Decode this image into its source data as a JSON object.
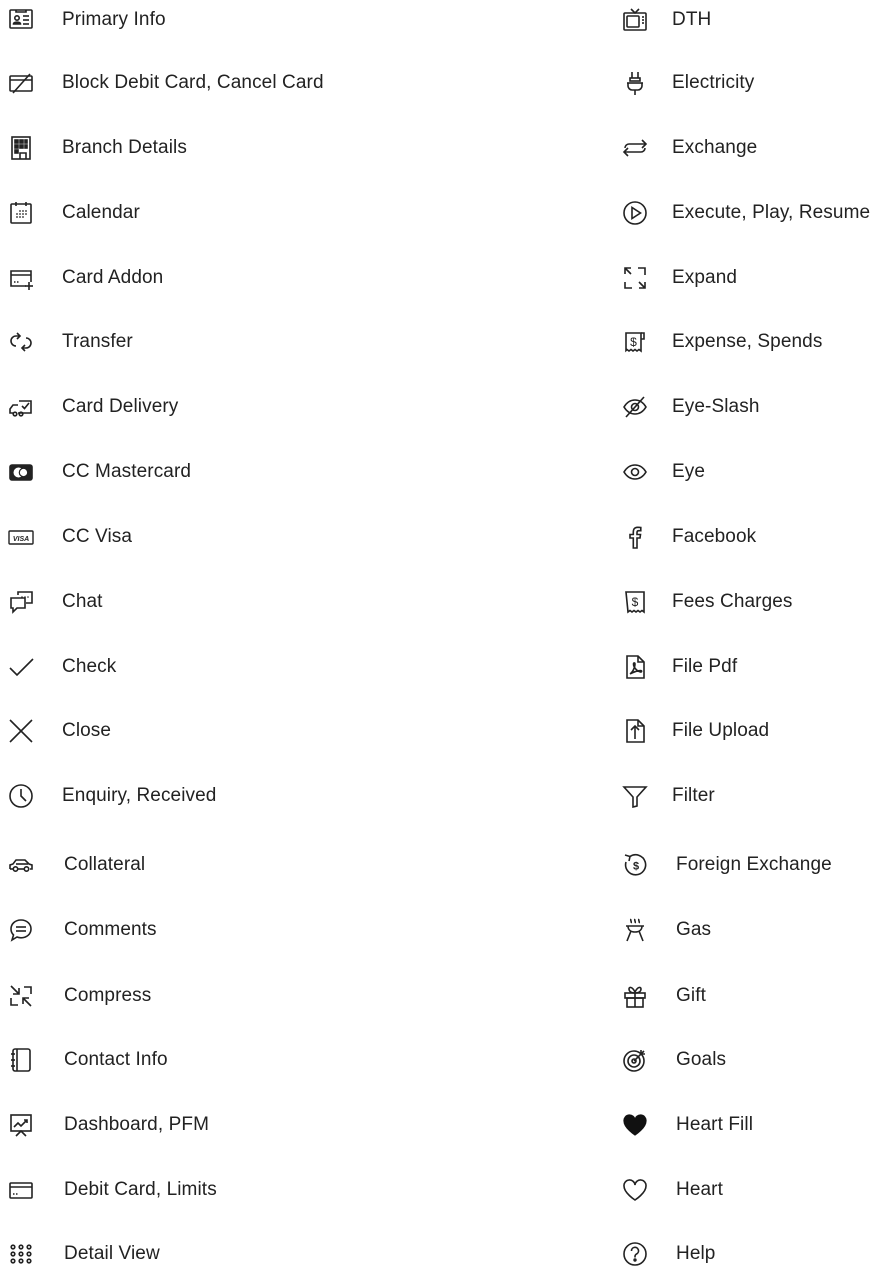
{
  "left": [
    {
      "label": "Primary Info",
      "icon": "id-card-icon"
    },
    {
      "label": "Block Debit Card, Cancel Card",
      "icon": "card-blocked-icon"
    },
    {
      "label": "Branch Details",
      "icon": "building-icon"
    },
    {
      "label": "Calendar",
      "icon": "calendar-icon"
    },
    {
      "label": "Card Addon",
      "icon": "card-plus-icon"
    },
    {
      "label": "Transfer",
      "icon": "transfer-icon"
    },
    {
      "label": "Card Delivery",
      "icon": "delivery-truck-icon"
    },
    {
      "label": "CC Mastercard",
      "icon": "mastercard-icon"
    },
    {
      "label": "CC Visa",
      "icon": "visa-icon"
    },
    {
      "label": "Chat",
      "icon": "chat-icon"
    },
    {
      "label": "Check",
      "icon": "check-icon"
    },
    {
      "label": "Close",
      "icon": "close-icon"
    },
    {
      "label": "Enquiry, Received",
      "icon": "clock-icon"
    },
    {
      "label": "Collateral",
      "icon": "car-icon"
    },
    {
      "label": "Comments",
      "icon": "comment-icon"
    },
    {
      "label": "Compress",
      "icon": "compress-icon"
    },
    {
      "label": "Contact Info",
      "icon": "address-book-icon"
    },
    {
      "label": "Dashboard, PFM",
      "icon": "dashboard-chart-icon"
    },
    {
      "label": "Debit Card, Limits",
      "icon": "debit-card-icon"
    },
    {
      "label": "Detail View",
      "icon": "dots-grid-icon"
    }
  ],
  "right": [
    {
      "label": "DTH",
      "icon": "tv-icon"
    },
    {
      "label": "Electricity",
      "icon": "plug-icon"
    },
    {
      "label": "Exchange",
      "icon": "exchange-arrows-icon"
    },
    {
      "label": "Execute, Play, Resume",
      "icon": "play-circle-icon"
    },
    {
      "label": "Expand",
      "icon": "expand-icon"
    },
    {
      "label": "Expense, Spends",
      "icon": "receipt-dollar-icon"
    },
    {
      "label": "Eye-Slash",
      "icon": "eye-slash-icon"
    },
    {
      "label": "Eye",
      "icon": "eye-icon"
    },
    {
      "label": "Facebook",
      "icon": "facebook-icon"
    },
    {
      "label": "Fees Charges",
      "icon": "fees-receipt-icon"
    },
    {
      "label": "File Pdf",
      "icon": "file-pdf-icon"
    },
    {
      "label": "File Upload",
      "icon": "file-upload-icon"
    },
    {
      "label": "Filter",
      "icon": "filter-icon"
    },
    {
      "label": "Foreign Exchange",
      "icon": "foreign-exchange-icon"
    },
    {
      "label": "Gas",
      "icon": "gas-stove-icon"
    },
    {
      "label": "Gift",
      "icon": "gift-icon"
    },
    {
      "label": "Goals",
      "icon": "target-icon"
    },
    {
      "label": "Heart Fill",
      "icon": "heart-fill-icon"
    },
    {
      "label": "Heart",
      "icon": "heart-icon"
    },
    {
      "label": "Help",
      "icon": "help-circle-icon"
    }
  ]
}
